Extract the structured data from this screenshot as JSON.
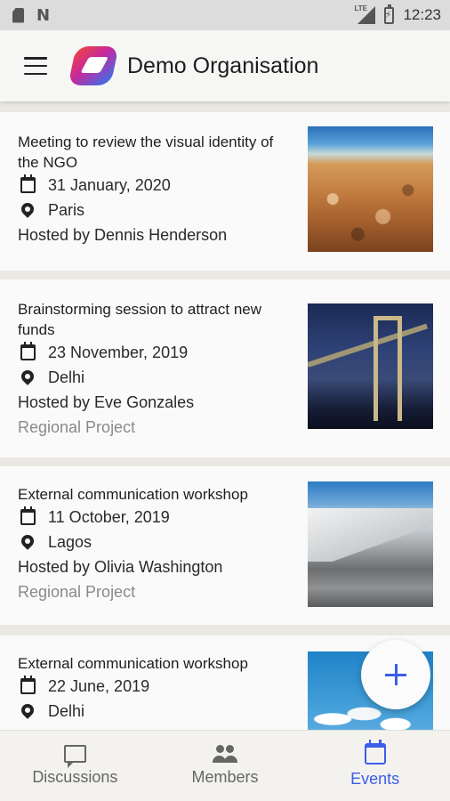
{
  "status_bar": {
    "time": "12:23",
    "network": "LTE"
  },
  "app_bar": {
    "title": "Demo Organisation"
  },
  "events": [
    {
      "title": "Meeting to review the visual identity of the NGO",
      "date": "31 January, 2020",
      "location": "Paris",
      "host": "Hosted by Dennis Henderson",
      "project": "",
      "image": "beach-pebbles"
    },
    {
      "title": "Brainstorming session to attract new funds",
      "date": "23 November, 2019",
      "location": "Delhi",
      "host": "Hosted by Eve Gonzales",
      "project": "Regional Project",
      "image": "bridge-night"
    },
    {
      "title": "External communication workshop",
      "date": "11 October, 2019",
      "location": "Lagos",
      "host": "Hosted by Olivia Washington",
      "project": "Regional Project",
      "image": "snowy-mountains"
    },
    {
      "title": "External communication workshop",
      "date": "22 June, 2019",
      "location": "Delhi",
      "host": "",
      "project": "",
      "image": "sky-clouds"
    }
  ],
  "bottom_nav": [
    {
      "label": "Discussions",
      "icon": "chat-icon",
      "active": false
    },
    {
      "label": "Members",
      "icon": "people-icon",
      "active": false
    },
    {
      "label": "Events",
      "icon": "calendar-icon",
      "active": true
    }
  ],
  "colors": {
    "accent": "#3c5de8",
    "background": "#e9e8e3",
    "card": "#fafafa"
  }
}
